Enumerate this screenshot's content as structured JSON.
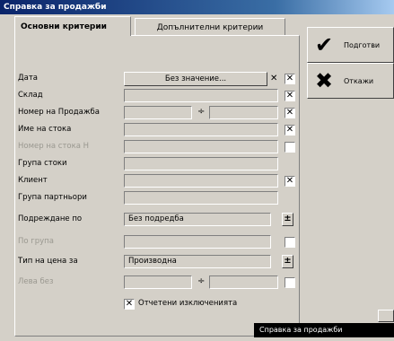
{
  "window": {
    "title": "Справка за продажби"
  },
  "tabs": [
    {
      "label": "Основни критерии"
    },
    {
      "label": "Допълнителни критерии"
    }
  ],
  "actions": {
    "ok_label": "Подготви",
    "cancel_label": "Откажи"
  },
  "form": {
    "date_label": "Дата",
    "date_value": "Без значение...",
    "date_clear": "✕",
    "warehouse_label": "Склад",
    "sale_number_label": "Номер на Продажба",
    "range_separator": "÷",
    "item_name_label": "Име на стока",
    "item_serial_label": "Номер на стока Н",
    "item_group_label": "Група стоки",
    "client_label": "Клиент",
    "partner_group_label": "Група партньори",
    "sort_label": "Подреждане по",
    "sort_value": "Без подредба",
    "subtotal_label": "По група",
    "price_type_label": "Тип на цена за",
    "price_type_value": "Производна",
    "value_label": "Лева без",
    "show_records_label": "Отчетени изключенията"
  },
  "checkbox_mark": "✕",
  "spin_glyph": "±",
  "tooltip": "Справка за продажби"
}
